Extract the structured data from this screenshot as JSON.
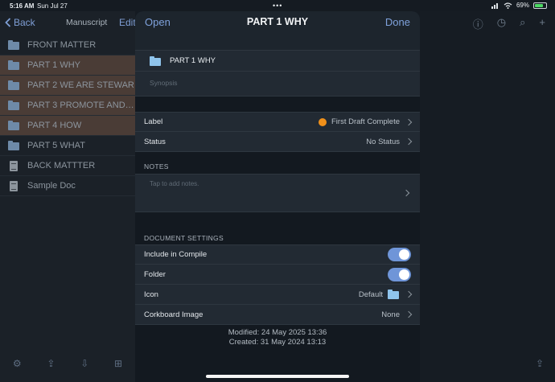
{
  "status_bar": {
    "time": "5:16 AM",
    "date": "Sun Jul 27",
    "dots": "•••",
    "battery": "69%"
  },
  "binder": {
    "back_label": "Back",
    "title": "Manuscript",
    "edit_label": "Edit",
    "items": [
      {
        "label": "FRONT MATTER",
        "icon": "folder-icon",
        "selected": false
      },
      {
        "label": "PART 1 WHY",
        "icon": "folder-icon",
        "selected": true
      },
      {
        "label": "PART 2 WE ARE STEWAR…",
        "icon": "folder-icon",
        "selected": true
      },
      {
        "label": "PART 3 PROMOTE AND…",
        "icon": "folder-icon",
        "selected": true
      },
      {
        "label": "PART 4 HOW",
        "icon": "folder-icon",
        "selected": true
      },
      {
        "label": "PART 5 WHAT",
        "icon": "folder-docs-icon",
        "selected": false
      },
      {
        "label": "BACK MATTTER",
        "icon": "document-icon",
        "selected": false
      },
      {
        "label": "Sample Doc",
        "icon": "document-icon",
        "selected": false
      }
    ]
  },
  "sheet": {
    "open_label": "Open",
    "title": "PART 1 WHY",
    "done_label": "Done",
    "doc_title": "PART 1 WHY",
    "synopsis_placeholder": "Synopsis",
    "label_row": {
      "label": "Label",
      "value": "First Draft Complete",
      "color": "#f0901a"
    },
    "status_row": {
      "label": "Status",
      "value": "No Status"
    },
    "notes_header": "NOTES",
    "notes_placeholder": "Tap to add notes.",
    "settings_header": "DOCUMENT SETTINGS",
    "include_compile": {
      "label": "Include in Compile",
      "on": true
    },
    "folder": {
      "label": "Folder",
      "on": true
    },
    "icon_row": {
      "label": "Icon",
      "value": "Default"
    },
    "corkboard_row": {
      "label": "Corkboard Image",
      "value": "None"
    },
    "modified": "Modified: 24 May 2025  13:36",
    "created": "Created: 31 May 2024  13:13"
  },
  "colors": {
    "accent": "#7fa2dc",
    "selection": "#4a3c36",
    "toggle_on": "#6f95d8"
  }
}
